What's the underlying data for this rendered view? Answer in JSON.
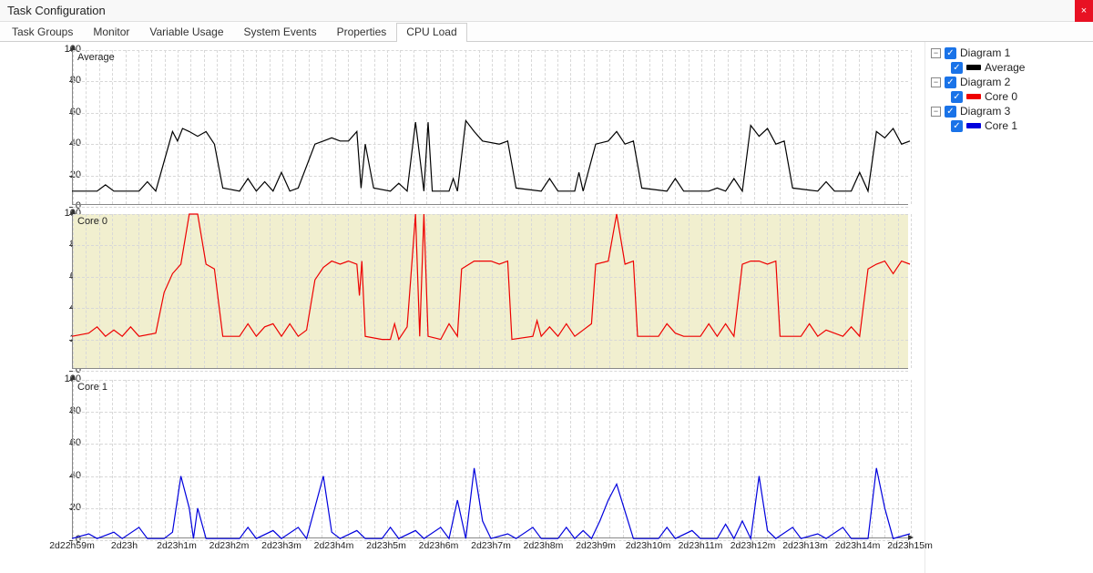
{
  "window": {
    "title": "Task Configuration"
  },
  "tabs": [
    {
      "label": "Task Groups",
      "active": false
    },
    {
      "label": "Monitor",
      "active": false
    },
    {
      "label": "Variable Usage",
      "active": false
    },
    {
      "label": "System Events",
      "active": false
    },
    {
      "label": "Properties",
      "active": false
    },
    {
      "label": "CPU Load",
      "active": true
    }
  ],
  "legend": {
    "groups": [
      {
        "group_label": "Diagram 1",
        "series_label": "Average",
        "swatch": "black"
      },
      {
        "group_label": "Diagram 2",
        "series_label": "Core 0",
        "swatch": "red"
      },
      {
        "group_label": "Diagram 3",
        "series_label": "Core 1",
        "swatch": "blue"
      }
    ]
  },
  "chart_data": [
    {
      "type": "line",
      "title": "Average",
      "color": "#000000",
      "ylim": [
        0,
        100
      ],
      "yticks": [
        0,
        20,
        40,
        60,
        80,
        100
      ],
      "x": [
        "2d22h59m",
        "2d23h",
        "2d23h1m",
        "2d23h2m",
        "2d23h3m",
        "2d23h4m",
        "2d23h5m",
        "2d23h6m",
        "2d23h7m",
        "2d23h8m",
        "2d23h9m",
        "2d23h10m",
        "2d23h11m",
        "2d23h12m",
        "2d23h13m",
        "2d23h14m",
        "2d23h15m"
      ],
      "highlight": false,
      "data": [
        [
          0,
          10
        ],
        [
          3,
          10
        ],
        [
          4,
          14
        ],
        [
          5,
          10
        ],
        [
          8,
          10
        ],
        [
          9,
          16
        ],
        [
          10,
          10
        ],
        [
          12,
          48
        ],
        [
          12.6,
          42
        ],
        [
          13.2,
          50
        ],
        [
          14,
          48
        ],
        [
          15,
          45
        ],
        [
          16,
          48
        ],
        [
          17,
          40
        ],
        [
          18,
          12
        ],
        [
          20,
          10
        ],
        [
          21,
          18
        ],
        [
          22,
          10
        ],
        [
          23,
          16
        ],
        [
          24,
          10
        ],
        [
          25,
          22
        ],
        [
          26,
          10
        ],
        [
          27,
          12
        ],
        [
          29,
          40
        ],
        [
          30,
          42
        ],
        [
          31,
          44
        ],
        [
          32,
          42
        ],
        [
          33,
          42
        ],
        [
          34,
          48
        ],
        [
          34.5,
          12
        ],
        [
          35,
          40
        ],
        [
          36,
          12
        ],
        [
          38,
          10
        ],
        [
          39,
          15
        ],
        [
          40,
          10
        ],
        [
          41,
          54
        ],
        [
          42,
          10
        ],
        [
          42.5,
          54
        ],
        [
          43,
          10
        ],
        [
          45,
          10
        ],
        [
          45.5,
          18
        ],
        [
          46,
          10
        ],
        [
          47,
          55
        ],
        [
          48,
          48
        ],
        [
          49,
          42
        ],
        [
          51,
          40
        ],
        [
          52,
          42
        ],
        [
          53,
          12
        ],
        [
          56,
          10
        ],
        [
          57,
          18
        ],
        [
          58,
          10
        ],
        [
          60,
          10
        ],
        [
          60.5,
          22
        ],
        [
          61,
          10
        ],
        [
          62.5,
          40
        ],
        [
          64,
          42
        ],
        [
          65,
          48
        ],
        [
          66,
          40
        ],
        [
          67,
          42
        ],
        [
          68,
          12
        ],
        [
          71,
          10
        ],
        [
          72,
          18
        ],
        [
          73,
          10
        ],
        [
          76,
          10
        ],
        [
          77,
          12
        ],
        [
          78,
          10
        ],
        [
          79,
          18
        ],
        [
          80,
          10
        ],
        [
          81,
          52
        ],
        [
          82,
          45
        ],
        [
          83,
          50
        ],
        [
          84,
          40
        ],
        [
          85,
          42
        ],
        [
          86,
          12
        ],
        [
          89,
          10
        ],
        [
          90,
          16
        ],
        [
          91,
          10
        ],
        [
          93,
          10
        ],
        [
          94,
          22
        ],
        [
          95,
          10
        ],
        [
          96,
          48
        ],
        [
          97,
          44
        ],
        [
          98,
          50
        ],
        [
          99,
          40
        ],
        [
          100,
          42
        ]
      ]
    },
    {
      "type": "line",
      "title": "Core 0",
      "color": "#ee0000",
      "ylim": [
        0,
        100
      ],
      "yticks": [
        0,
        20,
        40,
        60,
        80,
        100
      ],
      "x": [
        "2d22h59m",
        "2d23h",
        "2d23h1m",
        "2d23h2m",
        "2d23h3m",
        "2d23h4m",
        "2d23h5m",
        "2d23h6m",
        "2d23h7m",
        "2d23h8m",
        "2d23h9m",
        "2d23h10m",
        "2d23h11m",
        "2d23h12m",
        "2d23h13m",
        "2d23h14m",
        "2d23h15m"
      ],
      "highlight": true,
      "data": [
        [
          0,
          22
        ],
        [
          2,
          24
        ],
        [
          3,
          28
        ],
        [
          4,
          22
        ],
        [
          5,
          26
        ],
        [
          6,
          22
        ],
        [
          7,
          28
        ],
        [
          8,
          22
        ],
        [
          10,
          24
        ],
        [
          11,
          50
        ],
        [
          12,
          62
        ],
        [
          13,
          68
        ],
        [
          14,
          100
        ],
        [
          15,
          100
        ],
        [
          16,
          68
        ],
        [
          17,
          65
        ],
        [
          18,
          22
        ],
        [
          20,
          22
        ],
        [
          21,
          30
        ],
        [
          22,
          22
        ],
        [
          23,
          28
        ],
        [
          24,
          30
        ],
        [
          25,
          22
        ],
        [
          26,
          30
        ],
        [
          27,
          22
        ],
        [
          28,
          26
        ],
        [
          29,
          58
        ],
        [
          30,
          66
        ],
        [
          31,
          70
        ],
        [
          32,
          68
        ],
        [
          33,
          70
        ],
        [
          34,
          68
        ],
        [
          34.3,
          48
        ],
        [
          34.6,
          70
        ],
        [
          35,
          22
        ],
        [
          37,
          20
        ],
        [
          38,
          20
        ],
        [
          38.5,
          30
        ],
        [
          39,
          20
        ],
        [
          40,
          28
        ],
        [
          41,
          100
        ],
        [
          41.5,
          22
        ],
        [
          42,
          100
        ],
        [
          42.5,
          22
        ],
        [
          44,
          20
        ],
        [
          45,
          30
        ],
        [
          46,
          22
        ],
        [
          46.5,
          65
        ],
        [
          48,
          70
        ],
        [
          50,
          70
        ],
        [
          51,
          68
        ],
        [
          52,
          70
        ],
        [
          52.5,
          20
        ],
        [
          55,
          22
        ],
        [
          55.5,
          32
        ],
        [
          56,
          22
        ],
        [
          57,
          28
        ],
        [
          58,
          22
        ],
        [
          59,
          30
        ],
        [
          60,
          22
        ],
        [
          61,
          26
        ],
        [
          62,
          30
        ],
        [
          62.5,
          68
        ],
        [
          64,
          70
        ],
        [
          65,
          100
        ],
        [
          66,
          68
        ],
        [
          67,
          70
        ],
        [
          67.5,
          22
        ],
        [
          70,
          22
        ],
        [
          71,
          30
        ],
        [
          72,
          24
        ],
        [
          73,
          22
        ],
        [
          75,
          22
        ],
        [
          76,
          30
        ],
        [
          77,
          22
        ],
        [
          78,
          30
        ],
        [
          79,
          22
        ],
        [
          80,
          68
        ],
        [
          81,
          70
        ],
        [
          82,
          70
        ],
        [
          83,
          68
        ],
        [
          84,
          70
        ],
        [
          84.5,
          22
        ],
        [
          87,
          22
        ],
        [
          88,
          30
        ],
        [
          89,
          22
        ],
        [
          90,
          26
        ],
        [
          92,
          22
        ],
        [
          93,
          28
        ],
        [
          94,
          22
        ],
        [
          95,
          65
        ],
        [
          96,
          68
        ],
        [
          97,
          70
        ],
        [
          98,
          62
        ],
        [
          99,
          70
        ],
        [
          100,
          68
        ]
      ]
    },
    {
      "type": "line",
      "title": "Core 1",
      "color": "#0000dd",
      "ylim": [
        0,
        100
      ],
      "yticks": [
        0,
        20,
        40,
        60,
        80,
        100
      ],
      "x": [
        "2d22h59m",
        "2d23h",
        "2d23h1m",
        "2d23h2m",
        "2d23h3m",
        "2d23h4m",
        "2d23h5m",
        "2d23h6m",
        "2d23h7m",
        "2d23h8m",
        "2d23h9m",
        "2d23h10m",
        "2d23h11m",
        "2d23h12m",
        "2d23h13m",
        "2d23h14m",
        "2d23h15m"
      ],
      "highlight": false,
      "data": [
        [
          0,
          1
        ],
        [
          2,
          4
        ],
        [
          3,
          1
        ],
        [
          5,
          5
        ],
        [
          6,
          1
        ],
        [
          8,
          8
        ],
        [
          9,
          1
        ],
        [
          11,
          1
        ],
        [
          12,
          5
        ],
        [
          13,
          40
        ],
        [
          14,
          20
        ],
        [
          14.5,
          1
        ],
        [
          15,
          20
        ],
        [
          16,
          1
        ],
        [
          20,
          1
        ],
        [
          21,
          8
        ],
        [
          22,
          1
        ],
        [
          24,
          6
        ],
        [
          25,
          1
        ],
        [
          27,
          8
        ],
        [
          28,
          1
        ],
        [
          30,
          40
        ],
        [
          31,
          5
        ],
        [
          32,
          1
        ],
        [
          34,
          6
        ],
        [
          35,
          1
        ],
        [
          37,
          1
        ],
        [
          38,
          8
        ],
        [
          39,
          1
        ],
        [
          41,
          6
        ],
        [
          42,
          1
        ],
        [
          44,
          8
        ],
        [
          45,
          1
        ],
        [
          46,
          25
        ],
        [
          47,
          1
        ],
        [
          48,
          45
        ],
        [
          49,
          12
        ],
        [
          50,
          1
        ],
        [
          52,
          4
        ],
        [
          53,
          1
        ],
        [
          55,
          8
        ],
        [
          56,
          1
        ],
        [
          58,
          1
        ],
        [
          59,
          8
        ],
        [
          60,
          1
        ],
        [
          61,
          6
        ],
        [
          62,
          1
        ],
        [
          63,
          12
        ],
        [
          64,
          25
        ],
        [
          65,
          35
        ],
        [
          66,
          18
        ],
        [
          67,
          1
        ],
        [
          70,
          1
        ],
        [
          71,
          8
        ],
        [
          72,
          1
        ],
        [
          74,
          6
        ],
        [
          75,
          1
        ],
        [
          77,
          1
        ],
        [
          78,
          10
        ],
        [
          79,
          1
        ],
        [
          80,
          12
        ],
        [
          81,
          1
        ],
        [
          82,
          40
        ],
        [
          83,
          6
        ],
        [
          84,
          1
        ],
        [
          86,
          8
        ],
        [
          87,
          1
        ],
        [
          89,
          4
        ],
        [
          90,
          1
        ],
        [
          92,
          8
        ],
        [
          93,
          1
        ],
        [
          95,
          1
        ],
        [
          96,
          45
        ],
        [
          97,
          20
        ],
        [
          98,
          1
        ],
        [
          100,
          4
        ]
      ]
    }
  ],
  "axis": {
    "x_labels": [
      "2d22h59m",
      "2d23h",
      "2d23h1m",
      "2d23h2m",
      "2d23h3m",
      "2d23h4m",
      "2d23h5m",
      "2d23h6m",
      "2d23h7m",
      "2d23h8m",
      "2d23h9m",
      "2d23h10m",
      "2d23h11m",
      "2d23h12m",
      "2d23h13m",
      "2d23h14m",
      "2d23h15m"
    ]
  }
}
